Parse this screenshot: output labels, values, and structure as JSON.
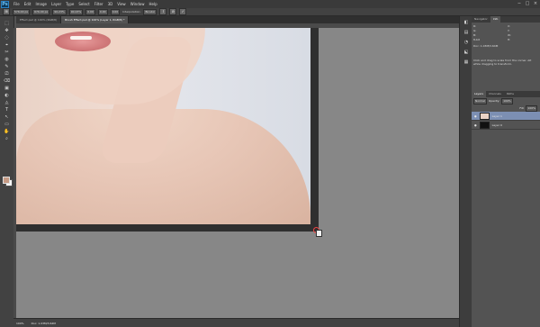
{
  "app": {
    "logo": "Ps"
  },
  "menu": [
    "File",
    "Edit",
    "Image",
    "Layer",
    "Type",
    "Select",
    "Filter",
    "3D",
    "View",
    "Window",
    "Help"
  ],
  "window_controls": [
    "−",
    "□",
    "×"
  ],
  "options_bar": {
    "fields": [
      "576.00 px",
      "676.00 px",
      "90.23%",
      "90.23%",
      "0.00",
      "0.00",
      "0.00"
    ],
    "interpolation_label": "Interpolation:",
    "interpolation_value": "Bicubic",
    "commit_icon": "✓",
    "cancel_icon": "⊘"
  },
  "tabs": [
    {
      "label": "Effect.psd @ 100% (RGB/8)",
      "active": false
    },
    {
      "label": "Brush Effect.psd @ 100% (Layer 1, RGB/8) *",
      "active": true
    }
  ],
  "tools": [
    "⬚",
    "✥",
    "◌",
    "⌖",
    "✂",
    "◍",
    "✎",
    "⎚",
    "⌫",
    "▣",
    "◐",
    "◬",
    "T",
    "↖",
    "▭",
    "✋",
    "⌕"
  ],
  "status": {
    "zoom": "100%",
    "doc": "Doc: 1.03M/3.64M"
  },
  "dock": [
    "◧",
    "▤",
    "◔",
    "⬕",
    "▦"
  ],
  "navigator": {
    "tabs": [
      "Navigator",
      "Info"
    ],
    "active_tab": "Info",
    "values": [
      "R:",
      "G:",
      "B:",
      "X:",
      "Y:",
      "8-bit",
      "W:",
      "H:"
    ],
    "doc_info": "Doc: 1.03M/3.64M",
    "hint": "Click and drag to scale from the corner. Alt while dragging to transform."
  },
  "layers_panel": {
    "tabs": [
      "Layers",
      "Channels",
      "Paths"
    ],
    "active_tab": "Layers",
    "blend_mode": "Normal",
    "opacity_label": "Opacity:",
    "opacity": "100%",
    "fill_label": "Fill:",
    "fill": "100%",
    "layers": [
      {
        "name": "Layer 1",
        "selected": true
      },
      {
        "name": "Layer 0",
        "selected": false
      }
    ]
  },
  "colors": {
    "accent_selection": "#7c8fb3",
    "foreground": "#c59a84",
    "background": "#ffffff"
  }
}
